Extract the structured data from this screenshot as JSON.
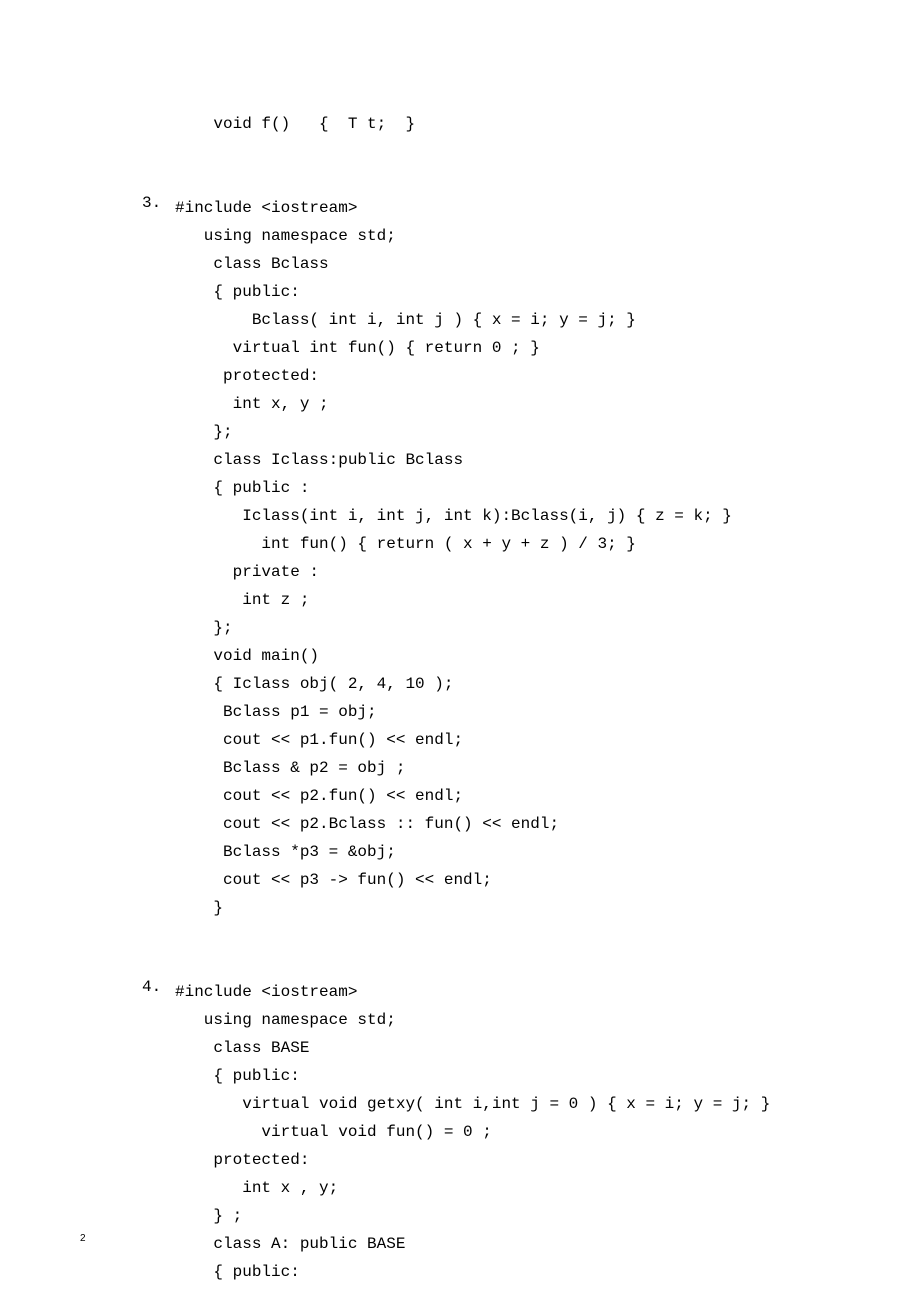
{
  "top_fragment": "    void f()   {  T t;  }",
  "section3": {
    "number": "3.",
    "lines": [
      "#include <iostream>",
      "   using namespace std;",
      "    class Bclass",
      "    { public:",
      "        Bclass( int i, int j ) { x = i; y = j; }",
      "      virtual int fun() { return 0 ; }",
      "     protected:",
      "      int x, y ;",
      "    };",
      "    class Iclass:public Bclass",
      "    { public :",
      "       Iclass(int i, int j, int k):Bclass(i, j) { z = k; }",
      "         int fun() { return ( x + y + z ) / 3; }",
      "      private :",
      "       int z ;",
      "    };",
      "    void main()",
      "    { Iclass obj( 2, 4, 10 );",
      "     Bclass p1 = obj;",
      "     cout << p1.fun() << endl;",
      "     Bclass & p2 = obj ;",
      "     cout << p2.fun() << endl;",
      "     cout << p2.Bclass :: fun() << endl;",
      "     Bclass *p3 = &obj;",
      "     cout << p3 -> fun() << endl;",
      "    }"
    ]
  },
  "section4": {
    "number": "4.",
    "lines": [
      "#include <iostream>",
      "   using namespace std;",
      "    class BASE",
      "    { public:",
      "       virtual void getxy( int i,int j = 0 ) { x = i; y = j; }",
      "         virtual void fun() = 0 ;",
      "    protected:",
      "       int x , y;",
      "    } ;",
      "    class A: public BASE",
      "    { public:"
    ]
  },
  "page_number": "2"
}
